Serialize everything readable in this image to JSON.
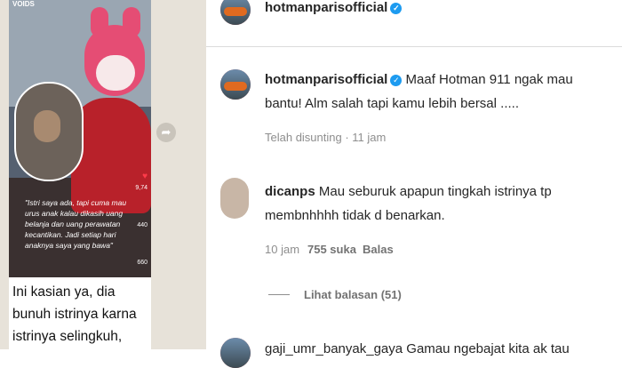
{
  "whatsapp_post": {
    "source_tag": "VOIDS",
    "video_caption": "\"Istri saya ada, tapi cuma mau urus anak kalau dikasih uang belanja dan uang perawatan kecantikan. Jadi setiap hari anaknya saya yang bawa\"",
    "stat_likes": "9,74",
    "stat_comments": "440",
    "stat_shares": "660",
    "message_text": "Ini kasian ya, dia bunuh istrinya karna istrinya selingkuh, selama ini jadi"
  },
  "post_header": {
    "username": "hotmanparisofficial"
  },
  "comments": [
    {
      "username": "hotmanparisofficial",
      "text": "Maaf Hotman 911 ngak mau bantu! Alm salah tapi kamu lebih bersal .....",
      "meta": "Telah disunting · 11 jam"
    },
    {
      "username": "dicanps",
      "text": "Mau seburuk apapun tingkah istrinya tp membnhhhh tidak d benarkan.",
      "time": "10 jam",
      "likes": "755 suka",
      "reply": "Balas",
      "view_replies": "Lihat balasan (51)"
    }
  ],
  "cut_comment": "gaji_umr_banyak_gaya Gamau ngebajat kita ak tau"
}
